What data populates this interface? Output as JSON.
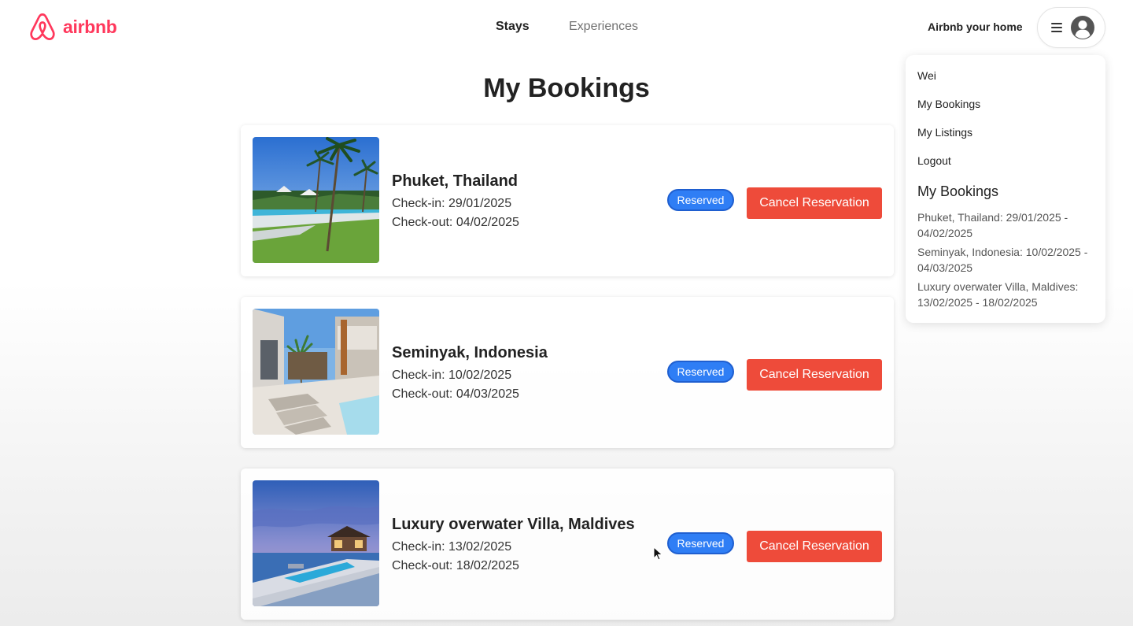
{
  "header": {
    "logo_text": "airbnb",
    "nav": {
      "stays": "Stays",
      "experiences": "Experiences"
    },
    "host_link": "Airbnb your home",
    "brand_color": "#ff385c"
  },
  "dropdown": {
    "items": [
      "Wei",
      "My Bookings",
      "My Listings",
      "Logout"
    ],
    "bookings_heading": "My Bookings",
    "bookings": [
      "Phuket, Thailand: 29/01/2025 - 04/02/2025",
      "Seminyak, Indonesia: 10/02/2025 - 04/03/2025",
      "Luxury overwater Villa, Maldives: 13/02/2025 - 18/02/2025"
    ]
  },
  "main": {
    "title": "My Bookings",
    "bookings": [
      {
        "title": "Phuket, Thailand",
        "checkin": "Check-in: 29/01/2025",
        "checkout": "Check-out: 04/02/2025",
        "status": "Reserved",
        "action": "Cancel Reservation",
        "image": "palm-beach-resort-image"
      },
      {
        "title": "Seminyak, Indonesia",
        "checkin": "Check-in: 10/02/2025",
        "checkout": "Check-out: 04/03/2025",
        "status": "Reserved",
        "action": "Cancel Reservation",
        "image": "villa-pool-image"
      },
      {
        "title": "Luxury overwater Villa, Maldives",
        "checkin": "Check-in: 13/02/2025",
        "checkout": "Check-out: 18/02/2025",
        "status": "Reserved",
        "action": "Cancel Reservation",
        "image": "overwater-villa-image"
      }
    ]
  },
  "colors": {
    "reserved_badge": "#2f7ef5",
    "cancel_button": "#ee4b3a"
  }
}
